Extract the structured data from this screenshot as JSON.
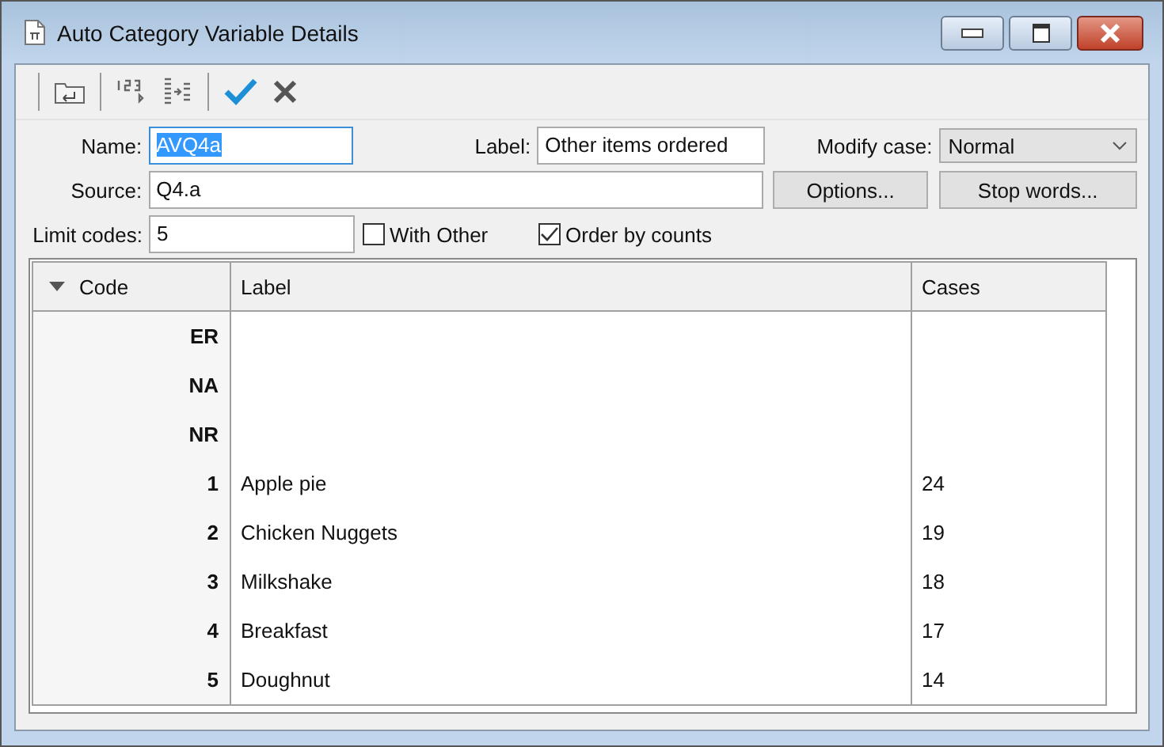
{
  "window": {
    "title": "Auto Category Variable Details"
  },
  "form": {
    "name": {
      "label": "Name:",
      "value": "AVQ4a"
    },
    "label": {
      "label": "Label:",
      "value": "Other items ordered"
    },
    "modify_case": {
      "label": "Modify case:",
      "value": "Normal"
    },
    "source": {
      "label": "Source:",
      "value": "Q4.a"
    },
    "options_button": "Options...",
    "stop_words_button": "Stop words...",
    "limit_codes": {
      "label": "Limit codes:",
      "value": "5"
    },
    "with_other": {
      "label": "With Other",
      "checked": false
    },
    "order_by_counts": {
      "label": "Order by counts",
      "checked": true
    }
  },
  "table": {
    "columns": [
      "Code",
      "Label",
      "Cases"
    ],
    "rows": [
      {
        "code": "ER",
        "label": "",
        "cases": ""
      },
      {
        "code": "NA",
        "label": "",
        "cases": ""
      },
      {
        "code": "NR",
        "label": "",
        "cases": ""
      },
      {
        "code": "1",
        "label": "Apple pie",
        "cases": "24"
      },
      {
        "code": "2",
        "label": "Chicken Nuggets",
        "cases": "19"
      },
      {
        "code": "3",
        "label": "Milkshake",
        "cases": "18"
      },
      {
        "code": "4",
        "label": "Breakfast",
        "cases": "17"
      },
      {
        "code": "5",
        "label": "Doughnut",
        "cases": "14"
      }
    ]
  }
}
